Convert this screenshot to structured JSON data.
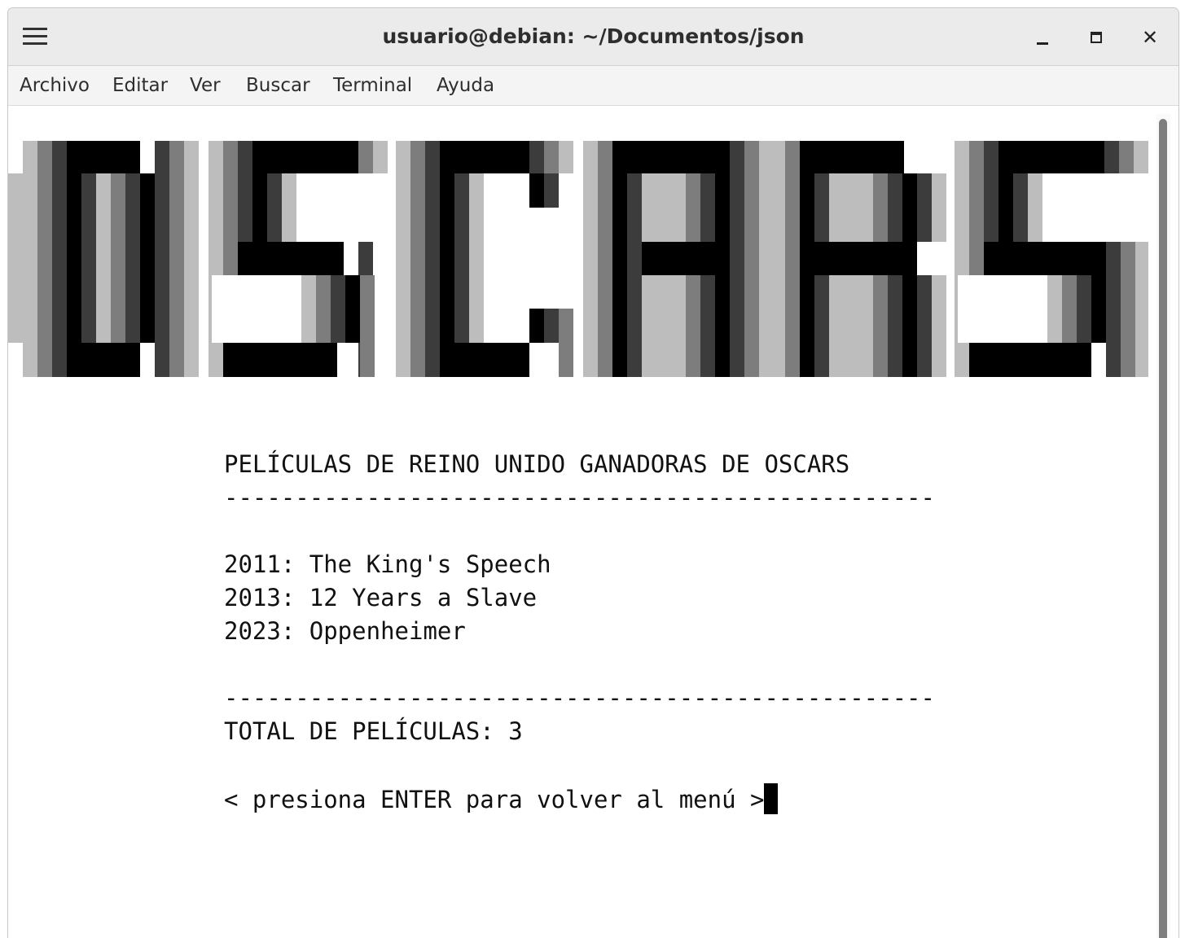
{
  "window": {
    "title": "usuario@debian: ~/Documentos/json",
    "close_glyph": "✕",
    "hamburger_icon": "hamburger-menu-icon"
  },
  "menubar": {
    "items": [
      {
        "label": "Archivo"
      },
      {
        "label": "Editar"
      },
      {
        "label": "Ver"
      },
      {
        "label": "Buscar"
      },
      {
        "label": "Terminal"
      },
      {
        "label": "Ayuda"
      }
    ]
  },
  "banner": {
    "text": "OSCARS",
    "colors": {
      "black": "#000000",
      "dark": "#3c3c3c",
      "mid": "#7d7d7d",
      "light": "#bdbdbd"
    }
  },
  "terminal": {
    "heading": "PELÍCULAS DE REINO UNIDO GANADORAS DE OSCARS",
    "separator": "--------------------------------------------------",
    "films": [
      {
        "year": "2011",
        "title": "The King's Speech"
      },
      {
        "year": "2013",
        "title": "12 Years a Slave"
      },
      {
        "year": "2023",
        "title": "Oppenheimer"
      }
    ],
    "total_label": "TOTAL DE PELÍCULAS:",
    "total_value": "3",
    "prompt": "< presiona ENTER para volver al menú >"
  }
}
